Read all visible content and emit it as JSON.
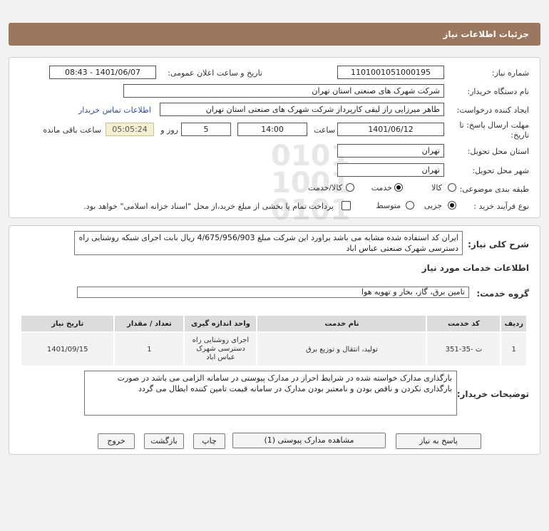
{
  "page_title": "جزئیات اطلاعات نیاز",
  "fields": {
    "need_number_label": "شماره نیاز:",
    "need_number": "1101001051000195",
    "announce_label": "تاریخ و ساعت اعلان عمومی:",
    "announce_value": "1401/06/07 - 08:43",
    "buyer_org_label": "نام دستگاه خریدار:",
    "buyer_org": "شرکت شهرک های صنعتی استان تهران",
    "creator_label": "ایجاد کننده درخواست:",
    "creator": "طاهر  میرزایی راز لیقی کارپرداز شرکت شهرک های صنعتی استان تهران",
    "contact_link": "اطلاعات تماس خریدار",
    "deadline_label_1": "مهلت ارسال پاسخ: تا",
    "deadline_label_2": "تاریخ:",
    "deadline_date": "1401/06/12",
    "time_label": "ساعت",
    "deadline_time": "14:00",
    "days_value": "5",
    "days_label": "روز و",
    "remaining_time": "05:05:24",
    "remaining_label": "ساعت باقی مانده",
    "province_label": "استان محل تحویل:",
    "province": "تهران",
    "city_label": "شهر محل تحویل:",
    "city": "تهران",
    "category_label": "طبقه بندی موضوعی:",
    "category_options": [
      "کالا",
      "خدمت",
      "کالا/خدمت"
    ],
    "purchase_type_label": "نوع فرآیند خرید :",
    "purchase_options": [
      "جزیی",
      "متوسط"
    ],
    "payment_note": "پرداخت تمام یا بخشی از مبلغ خرید،از محل \"اسناد خزانه اسلامی\" خواهد بود."
  },
  "summary": {
    "label": "شرح کلی نیاز:",
    "text": "ایران کد استفاده شده مشابه می باشد براورد این شرکت مبلغ 4/675/956/903 ریال بابت  اجرای شبکه روشنایی راه دسترسی شهرک صنعتی عباس اباد",
    "services_title": "اطلاعات خدمات مورد نیاز",
    "group_label": "گروه خدمت:",
    "group_value": "تامین برق، گاز، بخار و تهویه هوا"
  },
  "table": {
    "headers": [
      "ردیف",
      "کد خدمت",
      "نام خدمت",
      "واحد اندازه گیری",
      "تعداد / مقدار",
      "تاریخ نیاز"
    ],
    "rows": [
      [
        "1",
        "ت -35-351",
        "تولید، انتقال و توزیع برق",
        "اجرای روشنایی راه دسترسی شهرک عباس اباد",
        "1",
        "1401/09/15"
      ]
    ]
  },
  "buyer_notes": {
    "label": "توضیحات خریدار:",
    "text": "بارگذاری مدارک خواسته شده در شرایط احراز در مدارک پیوستی در سامانه الزامی می باشد در صورت بارگذاری نکردن و ناقص بودن و نامعتبر بودن مدارک در سامانه  قیمت تامین کننده ابطال می گردد"
  },
  "buttons": {
    "reply": "پاسخ به نیاز",
    "attachments": "مشاهده مدارک پیوستی (1)",
    "print": "چاپ",
    "back": "بازگشت",
    "exit": "خروج"
  },
  "watermark": {
    "brand": "ParsNamadData",
    "line1": "مرکز فرآیند اطلاعات مناقصه",
    "line2": "پایگاه اطلاع رسانی مناقصه",
    "phone": "۰۲۱-۸۸۳۴۹۶۷۰-۵"
  }
}
